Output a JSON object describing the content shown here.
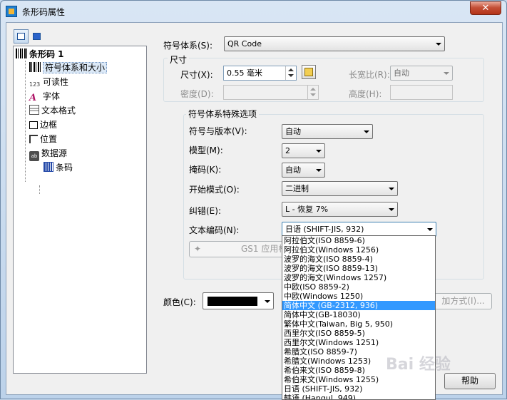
{
  "window": {
    "title": "条形码属性",
    "close_symbol": "✕"
  },
  "tree": {
    "root": "条形码 1",
    "items": [
      {
        "label": "符号体系和大小",
        "icon": "barcode-icon"
      },
      {
        "label": "可读性",
        "icon": "123-icon"
      },
      {
        "label": "字体",
        "icon": "font-icon"
      },
      {
        "label": "文本格式",
        "icon": "text-format-icon"
      },
      {
        "label": "边框",
        "icon": "border-icon"
      },
      {
        "label": "位置",
        "icon": "position-icon"
      },
      {
        "label": "数据源",
        "icon": "datasource-icon"
      }
    ],
    "child": {
      "label": "条码",
      "icon": "barcode-source-icon"
    }
  },
  "symbology": {
    "label": "符号体系(S):",
    "value": "QR Code"
  },
  "size": {
    "group_title": "尺寸",
    "size_label": "尺寸(X):",
    "size_value": "0.55 毫米",
    "aspect_label": "长宽比(R):",
    "aspect_value": "自动",
    "density_label": "密度(D):",
    "density_value": "",
    "height_label": "高度(H):",
    "height_value": ""
  },
  "options": {
    "group_title": "符号体系特殊选项",
    "version_label": "符号与版本(V):",
    "version_value": "自动",
    "model_label": "模型(M):",
    "model_value": "2",
    "mask_label": "掩码(K):",
    "mask_value": "自动",
    "start_label": "开始模式(O):",
    "start_value": "二进制",
    "ecc_label": "纠错(E):",
    "ecc_value": "L - 恢复 7%",
    "encoding_label": "文本编码(N):",
    "encoding_value": "日语 (SHIFT-JIS, 932)",
    "gs1_label": "GS1 应用标"
  },
  "color": {
    "label": "颜色(C):",
    "value": "#000000"
  },
  "buttons": {
    "method": "加方式(I)...",
    "help": "帮助"
  },
  "encoding_options": [
    "阿拉伯文(ISO 8859-6)",
    "阿拉伯文(Windows 1256)",
    "波罗的海文(ISO 8859-4)",
    "波罗的海文(ISO 8859-13)",
    "波罗的海文(Windows 1257)",
    "中欧(ISO 8859-2)",
    "中欧(Windows 1250)",
    "简体中文 (GB-2312, 936)",
    "简体中文(GB-18030)",
    "繁体中文(Taiwan, Big 5, 950)",
    "西里尔文(ISO 8859-5)",
    "西里尔文(Windows 1251)",
    "希腊文(ISO 8859-7)",
    "希腊文(Windows 1253)",
    "希伯来文(ISO 8859-8)",
    "希伯来文(Windows 1255)",
    "日语 (SHIFT-JIS, 932)",
    "韩语 (Hangul, 949)"
  ],
  "selected_encoding_index": 7,
  "watermark": "Bai 经验"
}
